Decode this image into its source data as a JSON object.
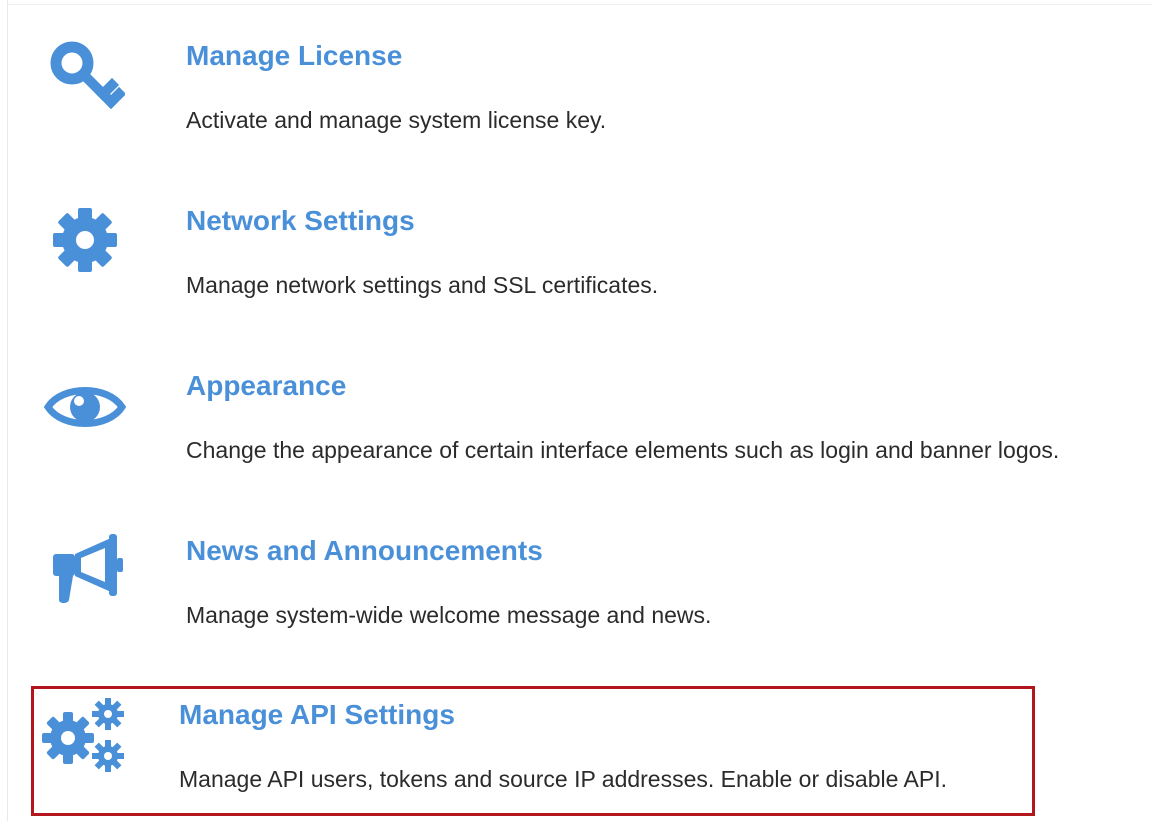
{
  "items": [
    {
      "title": "Manage License",
      "description": "Activate and manage system license key.",
      "icon": "key-icon"
    },
    {
      "title": "Network Settings",
      "description": "Manage network settings and SSL certificates.",
      "icon": "gear-icon"
    },
    {
      "title": "Appearance",
      "description": "Change the appearance of certain interface elements such as login and banner logos.",
      "icon": "eye-icon"
    },
    {
      "title": "News and Announcements",
      "description": "Manage system-wide welcome message and news.",
      "icon": "megaphone-icon"
    },
    {
      "title": "Manage API Settings",
      "description": "Manage API users, tokens and source IP addresses. Enable or disable API.",
      "icon": "gears-icon",
      "highlighted": true
    }
  ],
  "colors": {
    "accent": "#4a90d9",
    "text": "#2b2b2b",
    "highlight_border": "#b3161c"
  }
}
